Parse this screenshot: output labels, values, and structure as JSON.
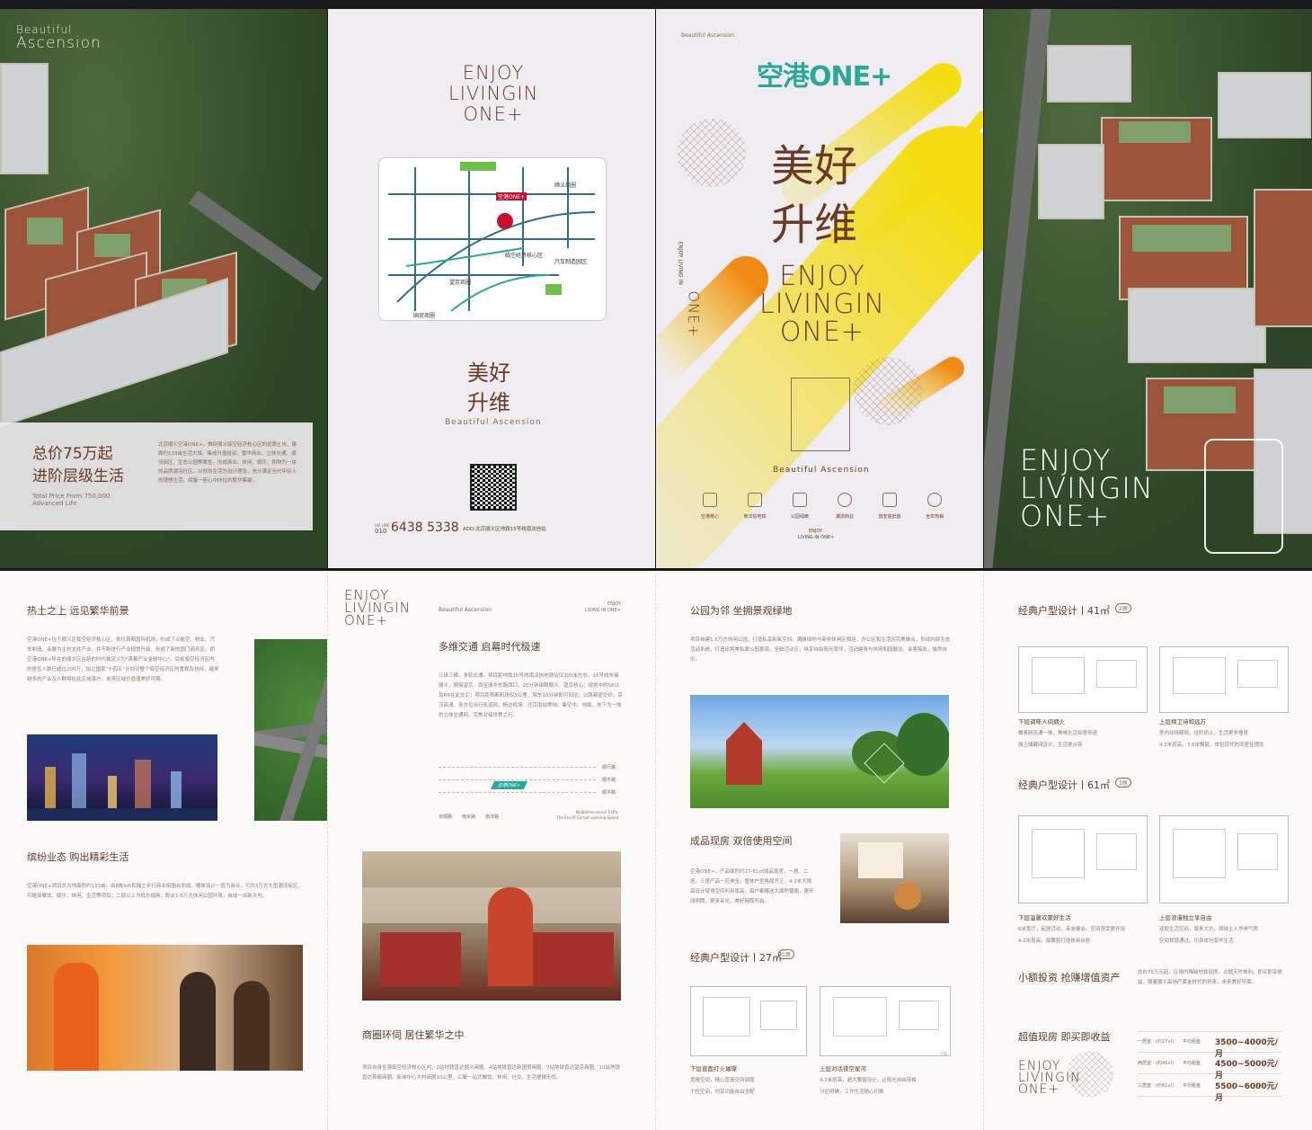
{
  "panel1": {
    "brand_small": "Beautiful",
    "brand_large": "Ascension",
    "headline1": "总价75万起",
    "headline2": "进阶层级生活",
    "en1": "Total Price From 750,000",
    "en2": "Advanced Life",
    "desc": "北京顺义空港ONE+，秉持顺义临空经济核心区的优质土块，建面约133亩生活大境。集成升值投资、繁华商业、立体交通、潮流街区、生态公园等属性，形成商业、休闲、娱乐、购物为一体的品质潮流社区，以时尚生活为设计理念，充分满足当代年轻人的理想生活，缔馨一座心中向往的繁华集聚。"
  },
  "panel2": {
    "enjoy1": "ENJOY",
    "enjoy2": "LIVINGIN",
    "enjoy3": "ONE+",
    "title1": "美好",
    "title2": "升维",
    "subtitle": "Beautiful Ascension",
    "hotline_label1": "VIP LINE",
    "hotline_label2": "010",
    "hotline": "6438 5338",
    "address": "ADD:北京顺义区地铁15号线南法信站",
    "map_labels": [
      "顺义商圈",
      "空港ONE+",
      "临空经济核心区",
      "汽车制造园区",
      "望京商圈",
      "国贸商圈"
    ]
  },
  "panel3": {
    "top_label": "Beautiful Ascension",
    "logo": "空港ONE+",
    "title1": "美好",
    "title2": "升维",
    "vertical1": "ENJOY LIVING IN",
    "vertical2": "ONE+",
    "enjoy1": "ENJOY",
    "enjoy2": "LIVINGIN",
    "enjoy3": "ONE+",
    "subtitle": "Beautiful Ascension",
    "icons": [
      "空港核心",
      "南法信地铁",
      "公园绿廊",
      "潮流商业",
      "首安首抵首",
      "全年热销"
    ],
    "footer1": "ENJOY",
    "footer2": "LIVING IN ONE+"
  },
  "panel4": {
    "enjoy1": "ENJOY",
    "enjoy2": "LIVINGIN",
    "enjoy3": "ONE+"
  },
  "inner1": {
    "h1": "热土之上 远见繁华前景",
    "p1": "空港ONE+位于顺义区临空经济核心区，依托首都国际机场，形成了以航空、物业、汽车制造、会展为主的支柱产业，并不断进行产业规划升级，形成了新的国门商务区。而空港ONE+所在的顺义区在新的时代被定义为\"首都产业金融中心\"。目前临空经济区内的居住人数已超过200万，加之国家\"十四五\"计划对整个临空经济区的重视及扶持，越来越多的产业及人群将在此区域落户，未来区域价值值美好可期。",
    "h2": "缤纷业态 购出精彩生活",
    "p2": "空港ONE+项目总占地面积约133亩，由8栋loft和独立步行商业街围合而成。楼体设计一层为商业，可共3万方大型潮流街区，可租赁餐饮、娱乐、休闲、生活等项目；二层以上为低总规商；配合1.6万方休闲公园环境，自成一派新天地。"
  },
  "inner2": {
    "enjoy1": "ENJOY",
    "enjoy2": "LIVINGIN",
    "enjoy3": "ONE+",
    "tag_left": "Beautiful Ascension",
    "tag_right1": "ENJOY",
    "tag_right2": "LIVING IN ONE+",
    "h1": "多维交通 启幕时代极速",
    "p1": "三纵三横，多轨交通。项目距地铁15号线南法信地铁站仅300米左右，15号线东接顺义，随接望京、西至清华东路西口，20分钟串联顺义、望京核心；规划中的S6以及R4在此交汇；项目距首都机场仅5公里，驾车10分钟即可到达；公路紧密交织，京汉高速、多方位出行轨道网，畅达机场、北京南站等地。集空中、地面、地下为一体的立体交通网，完美对接世界之行。",
    "line_labels": [
      "顺行路",
      "顺平路",
      "顺平路"
    ],
    "road_labels": [
      "京顺路",
      "南京路",
      "南法路"
    ],
    "station": "空港ONE+",
    "foot1": "Multidimensional Traffic",
    "foot2": "The Era Of Curtain-opening Speed",
    "h2": "商圈环伺 居住繁华之中",
    "p2": "项目自身坐落临空经济核心区内，2站地铁直达顺义商圈、4站地铁直达新国贸商圈、7站地铁直达望京商圈、10站地铁直达首都商圈，新城中心大村商圈10公里，汇聚一站式餐饮、休闲、社交、生活便捷无忧。"
  },
  "inner3": {
    "h1": "公园为邻 坐拥景观绿地",
    "p1": "项目自建1.6万方休闲公园，打造私享新氧空间。满脉绿地与商务休闲区相连，办公区和生活区完美融合，形成内部生态活动系统，打造出将美私属公园景观。全龄活动区，纵享自由阳光草坪，活动健身与休闲和园融洽，会客接友，愉然自乐。",
    "h2": "成品现房 双倍使用空间",
    "p2": "空港ONE+，产品面积约27-61㎡成品现房，一居、二居、三居产品一应俱全。整体户型格局方正，4.2米大挑高设计使得空间利用率高，每户都赠送大面积赠面，更开阔明朗，更多采光，美好随即开启。",
    "h3": "经典户型设计丨27㎡",
    "badge3": "1居",
    "plan_left_title": "下层直面打火璀璨",
    "plan_left_desc1": "宽敞空间，精心营造空间调度",
    "plan_left_desc2": "个性空间，创享功能自由支配",
    "plan_right_title": "上层对话夜空星河",
    "plan_right_desc1": "4.2米层高，超大飘窗设计，让阳光自由穿梭",
    "plan_right_desc2": "分区明确，工作生活随心切换",
    "plan_label": "二层"
  },
  "inner4": {
    "h1": "经典户型设计丨41㎡",
    "badge1": "2居",
    "a_left_title": "下层调味人间烟火",
    "a_left_desc1": "餐客厨连通一体，美味生活如意传递",
    "a_left_desc2": "独立储藏间设计，生活更从容",
    "a_right_title": "上层捍卫诗和远方",
    "a_right_desc1": "室内动线精简，拾阶而上，生活更多惬意",
    "a_right_desc2": "4.2米层高，3.6米飘窗，体验现代时尚居住理念",
    "h2": "经典户型设计丨61㎡",
    "badge2": "3居",
    "b_left_title": "下层温馨欢聚好生活",
    "b_left_desc1": "6米宽厅，起居活动，亲友聚会，空间感受更开阔",
    "b_left_desc2": "4.2米层高，临飘窗打造休闲台座",
    "b_right_title": "上层浪漫独立享自由",
    "b_right_desc1": "双层生活空间，尊贵大方，得映主人华贵气质",
    "b_right_desc2": "空间视感通过，切身体验豪华生活",
    "h3": "小额投资 抢赚增值资产",
    "p3": "总价75万元起，区域内稀缺地铁现房，占据天时地利，即买即享收益。随着顺义高地产黄金时代的到来，未来美好可期。",
    "h4": "超值现房 即买即收益",
    "enjoy1": "ENJOY",
    "enjoy2": "LIVINGIN",
    "enjoy3": "ONE+",
    "prices": [
      {
        "type": "一居室",
        "area": "(约27㎡)",
        "label": "平均租金",
        "value": "3500~4000元/月"
      },
      {
        "type": "两居室",
        "area": "(约41㎡)",
        "label": "平均租金",
        "value": "4500~5000元/月"
      },
      {
        "type": "三居室",
        "area": "(约61㎡)",
        "label": "平均租金",
        "value": "5500~6000元/月"
      }
    ]
  },
  "colors": {
    "brown": "#7a3a1c",
    "yellow": "#f3dd10",
    "orange": "#f08a14",
    "lavender": "#efecf2",
    "teal": "#2aa89a"
  }
}
